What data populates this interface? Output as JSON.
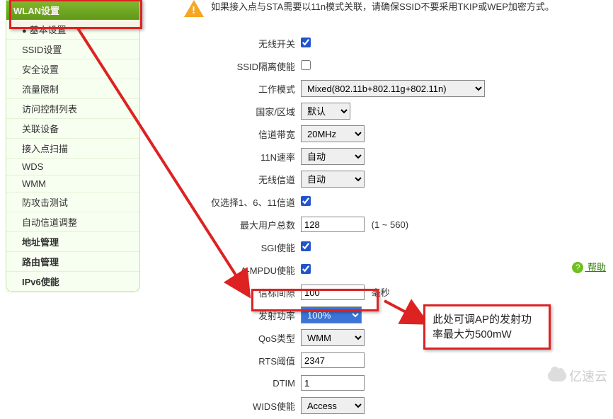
{
  "notice": "如果接入点与STA需要以11n模式关联，请确保SSID不要采用TKIP或WEP加密方式。",
  "sidebar": {
    "header": "WLAN设置",
    "items": [
      {
        "label": "基本设置",
        "cls": "bullet active"
      },
      {
        "label": "SSID设置",
        "cls": ""
      },
      {
        "label": "安全设置",
        "cls": ""
      },
      {
        "label": "流量限制",
        "cls": ""
      },
      {
        "label": "访问控制列表",
        "cls": ""
      },
      {
        "label": "关联设备",
        "cls": ""
      },
      {
        "label": "接入点扫描",
        "cls": ""
      },
      {
        "label": "WDS",
        "cls": ""
      },
      {
        "label": "WMM",
        "cls": ""
      },
      {
        "label": "防攻击测试",
        "cls": ""
      },
      {
        "label": "自动信道调整",
        "cls": ""
      },
      {
        "label": "地址管理",
        "cls": "bold"
      },
      {
        "label": "路由管理",
        "cls": "bold"
      },
      {
        "label": "IPv6使能",
        "cls": "bold"
      }
    ],
    "help": "帮助"
  },
  "form": {
    "wireless_switch": {
      "label": "无线开关",
      "checked": true
    },
    "ssid_isolation": {
      "label": "SSID隔离使能",
      "checked": false
    },
    "work_mode": {
      "label": "工作模式",
      "value": "Mixed(802.11b+802.11g+802.11n)"
    },
    "country": {
      "label": "国家/区域",
      "value": "默认"
    },
    "bandwidth": {
      "label": "信道带宽",
      "value": "20MHz"
    },
    "rate_11n": {
      "label": "11N速率",
      "value": "自动"
    },
    "channel": {
      "label": "无线信道",
      "value": "自动"
    },
    "only_1_6_11": {
      "label": "仅选择1、6、11信道",
      "checked": true
    },
    "max_users": {
      "label": "最大用户总数",
      "value": "128",
      "hint": "(1 ~ 560)"
    },
    "sgi": {
      "label": "SGI使能",
      "checked": true
    },
    "ampdu": {
      "label": "A-MPDU使能",
      "checked": true
    },
    "beacon": {
      "label": "信标间隙",
      "value": "100",
      "hint": "毫秒"
    },
    "tx_power": {
      "label": "发射功率",
      "value": "100%"
    },
    "qos": {
      "label": "QoS类型",
      "value": "WMM"
    },
    "rts": {
      "label": "RTS阈值",
      "value": "2347"
    },
    "dtim": {
      "label": "DTIM",
      "value": "1"
    },
    "wids": {
      "label": "WIDS使能",
      "value": "Access"
    }
  },
  "callout": "此处可调AP的发射功率最大为500mW",
  "watermark": "亿速云"
}
